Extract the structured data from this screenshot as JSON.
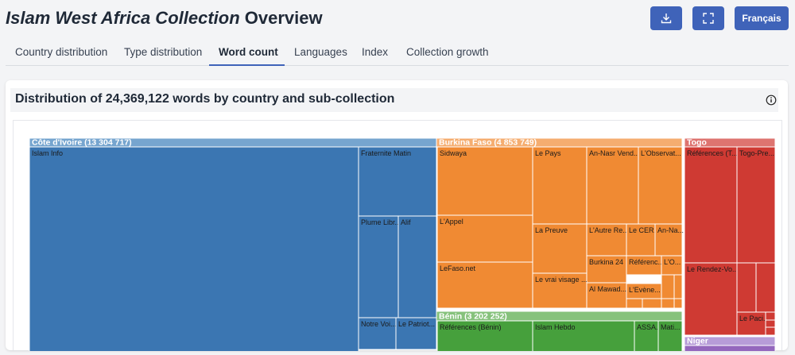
{
  "header": {
    "title_italic": "Islam West Africa Collection",
    "title_rest": "Overview",
    "language_button": "Français",
    "download_icon": "download-icon",
    "fullscreen_icon": "fullscreen-icon"
  },
  "tabs": [
    {
      "label": "Country distribution"
    },
    {
      "label": "Type distribution"
    },
    {
      "label": "Word count",
      "active": true
    },
    {
      "label": "Languages"
    },
    {
      "label": "Index"
    },
    {
      "label": "Collection growth"
    }
  ],
  "card": {
    "title": "Distribution of 24,369,122 words by country and sub-collection",
    "info_icon": "info-icon"
  },
  "chart_data": {
    "type": "treemap",
    "groups": [
      {
        "name": "Côte d'Ivoire",
        "label": "Côte d'Ivoire (13 304 717)",
        "value": 13304717,
        "color": "#3b76b2",
        "header": "#76a5cf",
        "items": [
          "Islam Info",
          "Fraternite Matin",
          "Plume Libr...",
          "Alif",
          "Notre Voi...",
          "Le Patriot..."
        ]
      },
      {
        "name": "Burkina Faso",
        "label": "Burkina Faso (4 853 749)",
        "value": 4853749,
        "color": "#f08a33",
        "header": "#f5ad70",
        "items": [
          "Sidwaya",
          "Le Pays",
          "An-Nasr Vend...",
          "L'Observat...",
          "L'Appel",
          "La Preuve",
          "L'Autre Re...",
          "Le CER...",
          "An-Na...",
          "LeFaso.net",
          "Burkina 24",
          "Référenc...",
          "L'O...",
          "Le vrai visage ...",
          "Al Mawad...",
          "L'Evène..."
        ]
      },
      {
        "name": "Togo",
        "label": "Togo",
        "value": null,
        "color": "#cf3a33",
        "header": "#de7470",
        "items": [
          "Références (T...",
          "Togo-Pre...",
          "Le Rendez-Vo...",
          "Le Paci..."
        ]
      },
      {
        "name": "Bénin",
        "label": "Bénin (3 202 252)",
        "value": 3202252,
        "color": "#46a03c",
        "header": "#86c27c",
        "items": [
          "Références (Bénin)",
          "Islam Hebdo",
          "ASSA...",
          "Mati..."
        ]
      },
      {
        "name": "Niger",
        "label": "Niger",
        "value": null,
        "color": "#9467bd",
        "header": "#b79cd8",
        "items": []
      }
    ]
  }
}
